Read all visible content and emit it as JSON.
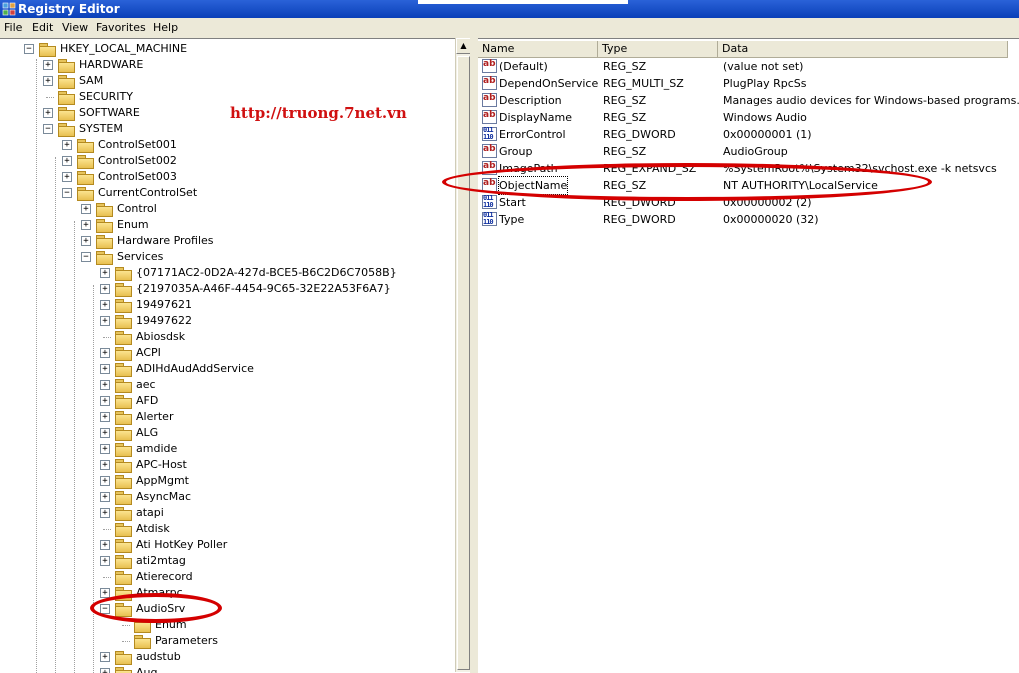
{
  "window": {
    "title": "Registry Editor"
  },
  "menu": [
    "File",
    "Edit",
    "View",
    "Favorites",
    "Help"
  ],
  "watermark": "http://truong.7net.vn",
  "tree": [
    {
      "label": "HKEY_LOCAL_MACHINE",
      "level": 0,
      "exp": "-"
    },
    {
      "label": "HARDWARE",
      "level": 1,
      "exp": "+"
    },
    {
      "label": "SAM",
      "level": 1,
      "exp": "+"
    },
    {
      "label": "SECURITY",
      "level": 1,
      "exp": ""
    },
    {
      "label": "SOFTWARE",
      "level": 1,
      "exp": "+"
    },
    {
      "label": "SYSTEM",
      "level": 1,
      "exp": "-"
    },
    {
      "label": "ControlSet001",
      "level": 2,
      "exp": "+"
    },
    {
      "label": "ControlSet002",
      "level": 2,
      "exp": "+"
    },
    {
      "label": "ControlSet003",
      "level": 2,
      "exp": "+"
    },
    {
      "label": "CurrentControlSet",
      "level": 2,
      "exp": "-"
    },
    {
      "label": "Control",
      "level": 3,
      "exp": "+"
    },
    {
      "label": "Enum",
      "level": 3,
      "exp": "+"
    },
    {
      "label": "Hardware Profiles",
      "level": 3,
      "exp": "+"
    },
    {
      "label": "Services",
      "level": 3,
      "exp": "-"
    },
    {
      "label": "{07171AC2-0D2A-427d-BCE5-B6C2D6C7058B}",
      "level": 4,
      "exp": "+"
    },
    {
      "label": "{2197035A-A46F-4454-9C65-32E22A53F6A7}",
      "level": 4,
      "exp": "+"
    },
    {
      "label": "19497621",
      "level": 4,
      "exp": "+"
    },
    {
      "label": "19497622",
      "level": 4,
      "exp": "+"
    },
    {
      "label": "Abiosdsk",
      "level": 4,
      "exp": ""
    },
    {
      "label": "ACPI",
      "level": 4,
      "exp": "+"
    },
    {
      "label": "ADIHdAudAddService",
      "level": 4,
      "exp": "+"
    },
    {
      "label": "aec",
      "level": 4,
      "exp": "+"
    },
    {
      "label": "AFD",
      "level": 4,
      "exp": "+"
    },
    {
      "label": "Alerter",
      "level": 4,
      "exp": "+"
    },
    {
      "label": "ALG",
      "level": 4,
      "exp": "+"
    },
    {
      "label": "amdide",
      "level": 4,
      "exp": "+"
    },
    {
      "label": "APC-Host",
      "level": 4,
      "exp": "+"
    },
    {
      "label": "AppMgmt",
      "level": 4,
      "exp": "+"
    },
    {
      "label": "AsyncMac",
      "level": 4,
      "exp": "+"
    },
    {
      "label": "atapi",
      "level": 4,
      "exp": "+"
    },
    {
      "label": "Atdisk",
      "level": 4,
      "exp": ""
    },
    {
      "label": "Ati HotKey Poller",
      "level": 4,
      "exp": "+"
    },
    {
      "label": "ati2mtag",
      "level": 4,
      "exp": "+"
    },
    {
      "label": "Atierecord",
      "level": 4,
      "exp": ""
    },
    {
      "label": "Atmarpc",
      "level": 4,
      "exp": "+"
    },
    {
      "label": "AudioSrv",
      "level": 4,
      "exp": "-"
    },
    {
      "label": "Enum",
      "level": 5,
      "exp": ""
    },
    {
      "label": "Parameters",
      "level": 5,
      "exp": ""
    },
    {
      "label": "audstub",
      "level": 4,
      "exp": "+"
    },
    {
      "label": "Aug",
      "level": 4,
      "exp": "+"
    }
  ],
  "columns": {
    "name": "Name",
    "type": "Type",
    "data": "Data"
  },
  "values": [
    {
      "name": "(Default)",
      "type": "REG_SZ",
      "data": "(value not set)",
      "icon": "ab"
    },
    {
      "name": "DependOnService",
      "type": "REG_MULTI_SZ",
      "data": "PlugPlay RpcSs",
      "icon": "ab"
    },
    {
      "name": "Description",
      "type": "REG_SZ",
      "data": "Manages audio devices for Windows-based programs. ...",
      "icon": "ab"
    },
    {
      "name": "DisplayName",
      "type": "REG_SZ",
      "data": "Windows Audio",
      "icon": "ab"
    },
    {
      "name": "ErrorControl",
      "type": "REG_DWORD",
      "data": "0x00000001 (1)",
      "icon": "bin"
    },
    {
      "name": "Group",
      "type": "REG_SZ",
      "data": "AudioGroup",
      "icon": "ab"
    },
    {
      "name": "ImagePath",
      "type": "REG_EXPAND_SZ",
      "data": "%SystemRoot%\\System32\\svchost.exe -k netsvcs",
      "icon": "ab"
    },
    {
      "name": "ObjectName",
      "type": "REG_SZ",
      "data": "NT AUTHORITY\\LocalService",
      "icon": "ab"
    },
    {
      "name": "Start",
      "type": "REG_DWORD",
      "data": "0x00000002 (2)",
      "icon": "bin"
    },
    {
      "name": "Type",
      "type": "REG_DWORD",
      "data": "0x00000020 (32)",
      "icon": "bin"
    }
  ]
}
